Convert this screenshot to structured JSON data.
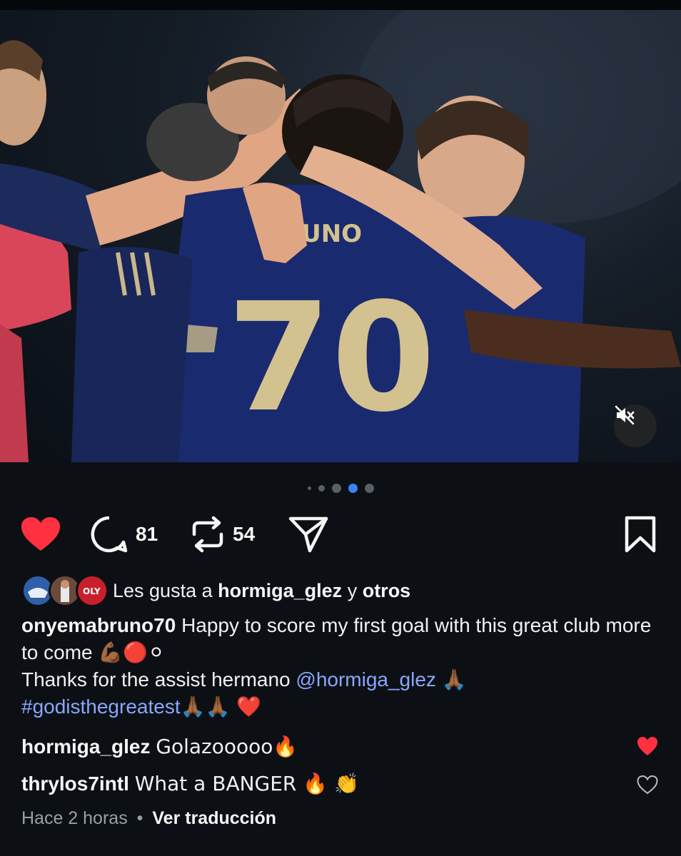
{
  "post": {
    "carousel": {
      "total": 5,
      "active_index": 3
    },
    "actions": {
      "comment_count": "81",
      "repost_count": "54",
      "liked": true
    },
    "likes": {
      "prefix": "Les gusta a",
      "user": "hormiga_glez",
      "joiner": "y",
      "others": "otros"
    },
    "caption": {
      "author": "onyemabruno70",
      "line1": "Happy to score my first goal with this great club more to come",
      "line1_emoji": "💪🏾🔴⚪",
      "line2_text": "Thanks for the assist hermano",
      "mention": "@hormiga_glez",
      "line2_emoji": "🙏🏾",
      "hashtag": "#godisthegreatest",
      "line3_emoji": "🙏🏾🙏🏾 ❤️"
    },
    "comments": [
      {
        "user": "hormiga_glez",
        "text": "Golazooooo🔥",
        "liked": true
      },
      {
        "user": "thrylos7intl",
        "text": "What a BANGER 🔥 👏",
        "liked": false
      }
    ],
    "meta": {
      "time": "Hace 2 horas",
      "separator": "•",
      "translate": "Ver traducción"
    },
    "colors": {
      "like_red": "#ff3040",
      "active_dot": "#3b82f6",
      "link": "#8aa6ff",
      "background": "#0c1014"
    }
  }
}
